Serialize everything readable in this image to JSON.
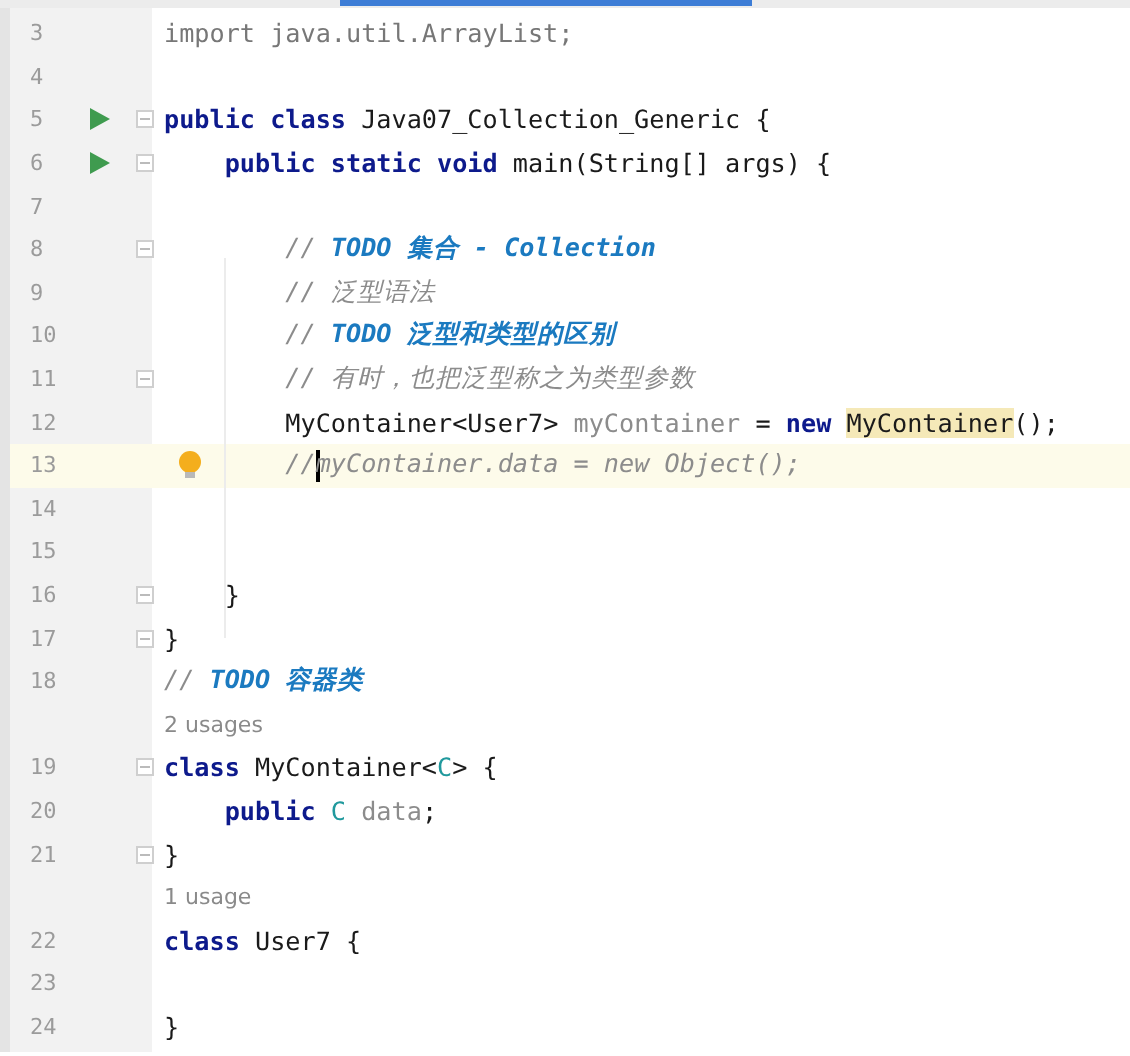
{
  "editor": {
    "lines": [
      {
        "kind": "code",
        "number": "3",
        "tokens": [
          {
            "text": "import",
            "kind": "import"
          },
          {
            "text": " java.util.ArrayList;",
            "kind": "import"
          }
        ]
      },
      {
        "kind": "code",
        "number": "4"
      },
      {
        "kind": "code",
        "number": "5",
        "run": true,
        "fold": true,
        "tokens": [
          {
            "text": "public class",
            "kind": "keyword"
          },
          {
            "text": " Java07_Collection_Generic {",
            "kind": "plain"
          }
        ]
      },
      {
        "kind": "code",
        "number": "6",
        "run": true,
        "fold": true,
        "tokens": [
          {
            "text": "    public static void",
            "kind": "keyword"
          },
          {
            "text": " main(String[] args) {",
            "kind": "plain"
          }
        ]
      },
      {
        "kind": "code",
        "number": "7"
      },
      {
        "kind": "code",
        "number": "8",
        "fold": true,
        "tokens": [
          {
            "text": "        //",
            "kind": "comment"
          },
          {
            "text": " TODO 集合 - Collection",
            "kind": "todo"
          }
        ]
      },
      {
        "kind": "code",
        "number": "9",
        "tokens": [
          {
            "text": "        // 泛型语法",
            "kind": "comment"
          }
        ]
      },
      {
        "kind": "code",
        "number": "10",
        "tokens": [
          {
            "text": "        //",
            "kind": "comment"
          },
          {
            "text": " TODO 泛型和类型的区别",
            "kind": "todo"
          }
        ]
      },
      {
        "kind": "code",
        "number": "11",
        "fold": true,
        "tokens": [
          {
            "text": "        // 有时，也把泛型称之为类型参数",
            "kind": "comment"
          }
        ]
      },
      {
        "kind": "code",
        "number": "12",
        "tokens": [
          {
            "text": "        MyContainer<User7>",
            "kind": "plain"
          },
          {
            "text": " myContainer",
            "kind": "unused"
          },
          {
            "text": " = ",
            "kind": "plain"
          },
          {
            "text": "new ",
            "kind": "keyword"
          },
          {
            "text": "MyContainer",
            "kind": "highlight"
          },
          {
            "text": "();",
            "kind": "plain"
          }
        ]
      },
      {
        "kind": "code",
        "number": "13",
        "current": true,
        "bulb": true,
        "tokens": [
          {
            "text": "        //",
            "kind": "comment"
          },
          {
            "text": "myContainer.data = new Object();",
            "kind": "comment",
            "caret_before": true
          }
        ]
      },
      {
        "kind": "code",
        "number": "14"
      },
      {
        "kind": "code",
        "number": "15"
      },
      {
        "kind": "code",
        "number": "16",
        "fold": true,
        "tokens": [
          {
            "text": "    }",
            "kind": "plain"
          }
        ]
      },
      {
        "kind": "code",
        "number": "17",
        "fold": true,
        "tokens": [
          {
            "text": "}",
            "kind": "plain"
          }
        ]
      },
      {
        "kind": "code",
        "number": "18",
        "tokens": [
          {
            "text": "//",
            "kind": "comment"
          },
          {
            "text": " TODO 容器类",
            "kind": "todo"
          }
        ]
      },
      {
        "kind": "hint",
        "text": "2 usages"
      },
      {
        "kind": "code",
        "number": "19",
        "fold": true,
        "tokens": [
          {
            "text": "class",
            "kind": "keyword"
          },
          {
            "text": " MyContainer<",
            "kind": "plain"
          },
          {
            "text": "C",
            "kind": "typeparam"
          },
          {
            "text": "> {",
            "kind": "plain"
          }
        ]
      },
      {
        "kind": "code",
        "number": "20",
        "tokens": [
          {
            "text": "    public ",
            "kind": "keyword"
          },
          {
            "text": "C",
            "kind": "typeparam"
          },
          {
            "text": " data",
            "kind": "unused"
          },
          {
            "text": ";",
            "kind": "plain"
          }
        ]
      },
      {
        "kind": "code",
        "number": "21",
        "fold": true,
        "tokens": [
          {
            "text": "}",
            "kind": "plain"
          }
        ]
      },
      {
        "kind": "hint",
        "text": "1 usage"
      },
      {
        "kind": "code",
        "number": "22",
        "tokens": [
          {
            "text": "class",
            "kind": "keyword"
          },
          {
            "text": " User7 {",
            "kind": "plain"
          }
        ]
      },
      {
        "kind": "code",
        "number": "23"
      },
      {
        "kind": "code",
        "number": "24",
        "tokens": [
          {
            "text": "}",
            "kind": "plain"
          }
        ]
      }
    ]
  }
}
